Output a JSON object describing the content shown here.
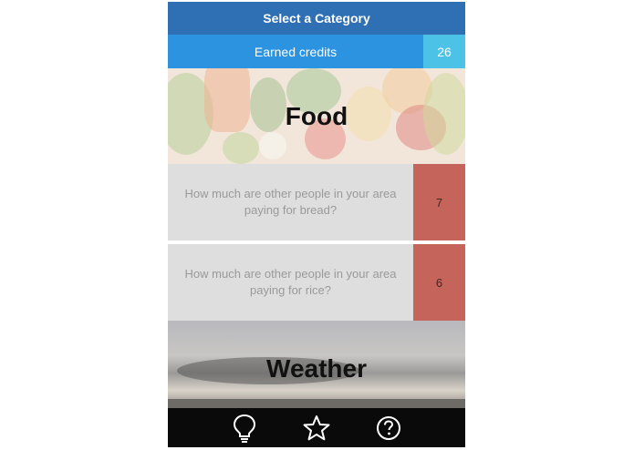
{
  "header": {
    "title": "Select a Category"
  },
  "credits": {
    "label": "Earned credits",
    "value": "26"
  },
  "categories": [
    {
      "title": "Food",
      "questions": [
        {
          "text": "How much are other people in your area paying for bread?",
          "credits": "7"
        },
        {
          "text": "How much are other people in your area paying for rice?",
          "credits": "6"
        }
      ]
    },
    {
      "title": "Weather"
    }
  ],
  "tabbar": {
    "icons": [
      "lightbulb-icon",
      "star-icon",
      "help-icon"
    ]
  },
  "colors": {
    "header": "#2f6fb3",
    "credits_bar": "#2c93e0",
    "credits_value": "#4cc3e6",
    "question_credit": "#c4645a",
    "tabbar": "#0a0a0a"
  }
}
